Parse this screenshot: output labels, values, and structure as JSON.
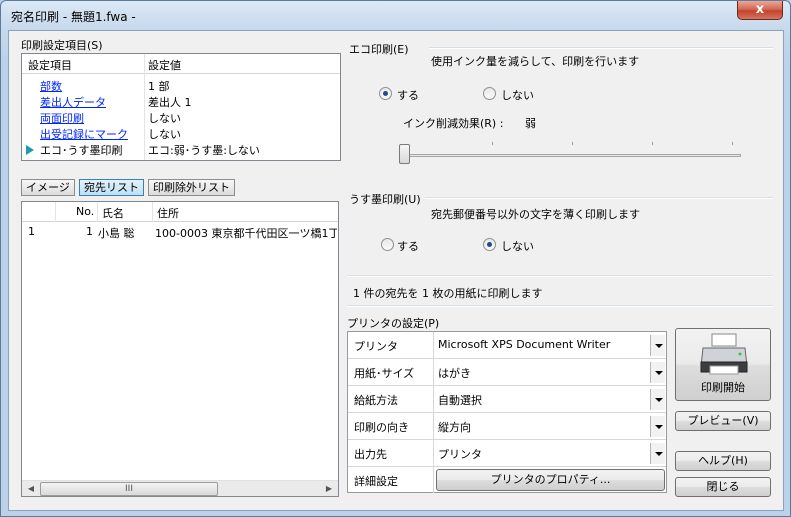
{
  "window": {
    "title": "宛名印刷  - 無題1.fwa -",
    "close_glyph": "x"
  },
  "settings": {
    "group_label": "印刷設定項目(S)",
    "col_key": "設定項目",
    "col_value": "設定値",
    "rows": [
      {
        "key": "部数",
        "value": "1 部"
      },
      {
        "key": "差出人データ",
        "value": "差出人 1"
      },
      {
        "key": "両面印刷",
        "value": "しない"
      },
      {
        "key": "出受記録にマーク",
        "value": "しない"
      },
      {
        "key": "エコ･うす墨印刷",
        "value": "エコ:弱･うす墨:しない"
      }
    ]
  },
  "tabs": [
    {
      "label": "イメージ"
    },
    {
      "label": "宛先リスト"
    },
    {
      "label": "印刷除外リスト"
    }
  ],
  "address_list": {
    "headers": {
      "no": "No.",
      "name": "氏名",
      "address": "住所"
    },
    "rows": [
      {
        "index": "1",
        "no": "1",
        "name": "小島 聡",
        "address": "100-0003 東京都千代田区一ツ橋1丁"
      }
    ],
    "scroll_grip": "III"
  },
  "eco": {
    "label": "エコ印刷(E)",
    "description": "使用インク量を減らして、印刷を行います",
    "on_label": "する",
    "off_label": "しない",
    "selected": "on",
    "reduction_label": "インク削減効果(R) :",
    "reduction_value": "弱",
    "slider_level": 0
  },
  "thin_ink": {
    "label": "うす墨印刷(U)",
    "description": "宛先郵便番号以外の文字を薄く印刷します",
    "on_label": "する",
    "off_label": "しない",
    "selected": "off"
  },
  "summary": "1 件の宛先を 1 枚の用紙に印刷します",
  "printer": {
    "group_label": "プリンタの設定(P)",
    "rows": [
      {
        "label": "プリンタ",
        "value": "Microsoft XPS Document Writer"
      },
      {
        "label": "用紙･サイズ",
        "value": "はがき"
      },
      {
        "label": "給紙方法",
        "value": "自動選択"
      },
      {
        "label": "印刷の向き",
        "value": "縦方向"
      },
      {
        "label": "出力先",
        "value": "プリンタ"
      }
    ],
    "details_label": "詳細設定",
    "properties_button": "プリンタのプロパティ..."
  },
  "buttons": {
    "print": "印刷開始",
    "preview": "プレビュー(V)",
    "help": "ヘルプ(H)",
    "close": "閉じる"
  }
}
